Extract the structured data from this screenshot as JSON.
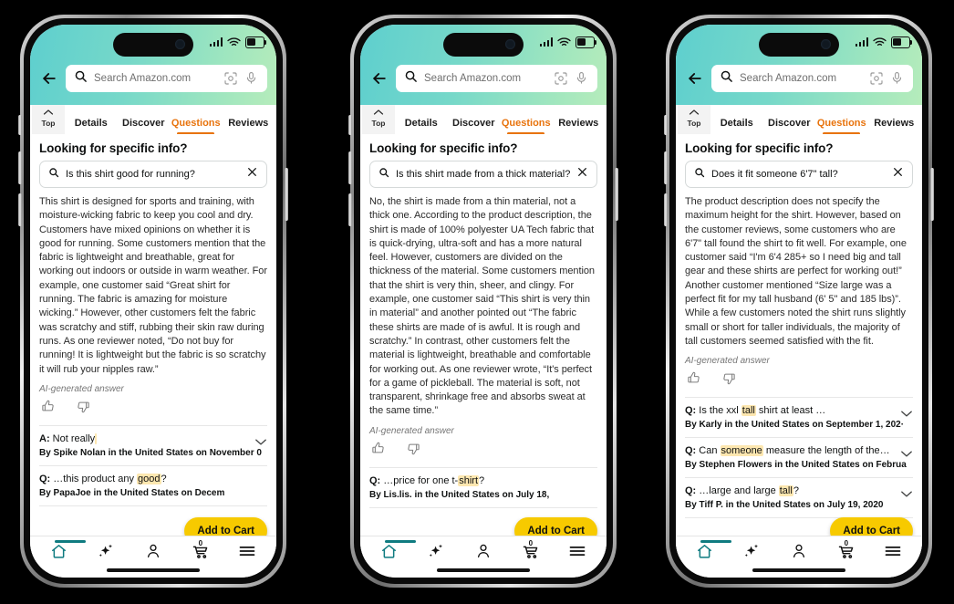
{
  "status": {
    "signal_icon": "cellular-bars-icon",
    "wifi_icon": "wifi-icon",
    "battery_icon": "battery-icon"
  },
  "colors": {
    "header_gradient_start": "#5ecfce",
    "header_gradient_end": "#b6ecbb",
    "accent_orange": "#e8730c",
    "cart_yellow": "#f7ca00",
    "highlight": "#fde7b0",
    "nav_active": "#0f7b80"
  },
  "search": {
    "placeholder": "Search Amazon.com",
    "back_icon": "back-arrow-icon",
    "search_icon": "search-icon",
    "camera_icon": "lens-camera-icon",
    "mic_icon": "microphone-icon"
  },
  "tabs": {
    "top_label": "Top",
    "items": [
      {
        "label": "Details",
        "active": false
      },
      {
        "label": "Discover",
        "active": false
      },
      {
        "label": "Questions",
        "active": true
      },
      {
        "label": "Reviews",
        "active": false
      }
    ]
  },
  "section": {
    "title": "Looking for specific info?"
  },
  "labels": {
    "ai_generated": "AI-generated answer",
    "add_to_cart": "Add to Cart",
    "cart_count": "0"
  },
  "nav": {
    "items": [
      {
        "icon": "home-icon",
        "active": true
      },
      {
        "icon": "sparkle-rufus-icon",
        "active": false
      },
      {
        "icon": "account-person-icon",
        "active": false
      },
      {
        "icon": "shopping-cart-icon",
        "active": false
      },
      {
        "icon": "hamburger-menu-icon",
        "active": false
      }
    ]
  },
  "phones": [
    {
      "query": "Is this shirt good for running?",
      "answer": "This shirt is designed for sports and training, with moisture-wicking fabric to keep you cool and dry. Customers have mixed opinions on whether it is good for running. Some customers mention that the fabric is lightweight and breathable, great for working out indoors or outside in warm weather. For example, one customer said “Great shirt for running. The fabric is amazing for moisture wicking.” However, other customers felt the fabric was scratchy and stiff, rubbing their skin raw during runs. As one reviewer noted, “Do not buy for running! It is lightweight but the fabric is so scratchy it will rub your nipples raw.”",
      "qa": [
        {
          "prefix": "A:",
          "text": "Not really",
          "highlight": "",
          "after": "",
          "byline": "By Spike Nolan in the United States on November 0",
          "chevron": true
        },
        {
          "prefix": "Q:",
          "text": "…this product any ",
          "highlight": "good",
          "after": "?",
          "byline": "By PapaJoe in the United States on Decem",
          "chevron": false
        }
      ]
    },
    {
      "query": "Is this shirt made from a thick material?",
      "answer": "No, the shirt is made from a thin material, not a thick one. According to the product description, the shirt is made of 100% polyester UA Tech fabric that is quick-drying, ultra-soft and has a more natural feel. However, customers are divided on the thickness of the material. Some customers mention that the shirt is very thin, sheer, and clingy. For example, one customer said “This shirt is very thin in material” and another pointed out “The fabric these shirts are made of is awful. It is rough and scratchy.” In contrast, other customers felt the material is lightweight, breathable and comfortable for working out. As one reviewer wrote, “It's perfect for a game of pickleball. The material is soft, not transparent, shrinkage free and absorbs sweat at the same time.”",
      "qa": [
        {
          "prefix": "Q:",
          "text": "…price for one t-",
          "highlight": "shirt",
          "after": "?",
          "byline": "By Lis.lis. in the United States on July 18, ",
          "chevron": false
        }
      ]
    },
    {
      "query": "Does it fit someone 6'7\" tall?",
      "answer": "The product description does not specify the maximum height for the shirt. However, based on the customer reviews, some customers who are 6'7\" tall found the shirt to fit well. For example, one customer said “I'm 6'4 285+ so I need big and tall gear and these shirts are perfect for working out!” Another customer mentioned “Size large was a perfect fit for my tall husband (6' 5\" and 185 lbs)”. While a few customers noted the shirt runs slightly small or short for taller individuals, the majority of tall customers seemed satisfied with the fit.",
      "qa": [
        {
          "prefix": "Q:",
          "text": "Is the xxl ",
          "highlight": "tall",
          "after": " shirt at least …",
          "byline": "By Karly in the United States on September 1, 202·",
          "chevron": true
        },
        {
          "prefix": "Q:",
          "text": "Can ",
          "highlight": "someone",
          "after": " measure the length of the…",
          "byline": "By Stephen Flowers in the United States on Februa",
          "chevron": true
        },
        {
          "prefix": "Q:",
          "text": "…large and large ",
          "highlight": "tall",
          "after": "?",
          "byline": "By Tiff P. in the United States on July 19, 2020",
          "chevron": true
        }
      ]
    }
  ]
}
